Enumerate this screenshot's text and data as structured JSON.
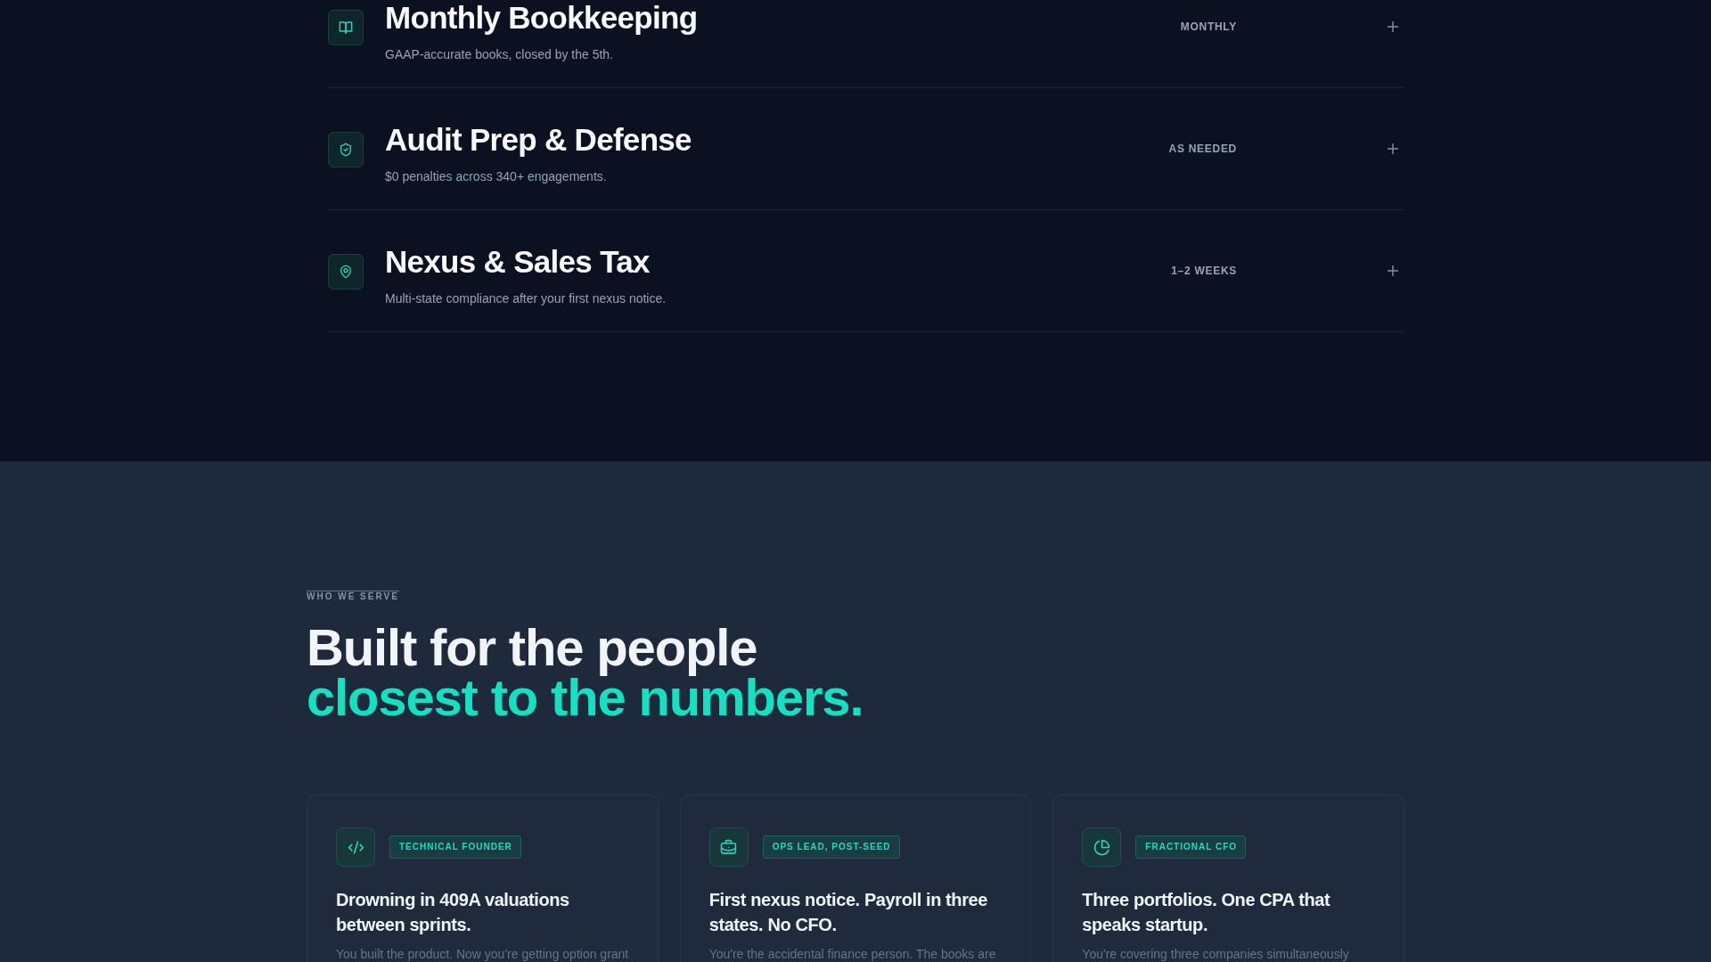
{
  "services": [
    {
      "title": "Monthly Bookkeeping",
      "description": "GAAP-accurate books, closed by the 5th.",
      "cadence": "MONTHLY",
      "expanded": false
    },
    {
      "title": "Audit Prep & Defense",
      "description": "$0 penalties across 340+ engagements.",
      "cadence": "AS NEEDED",
      "expanded": false
    },
    {
      "title": "Nexus & Sales Tax",
      "description": "Multi-state compliance after your first nexus notice.",
      "cadence": "1–2 WEEKS",
      "expanded": false
    }
  ],
  "audience": {
    "eyebrow": "WHO WE SERVE",
    "heading": "Built for the people",
    "heading_accent": "closest to the numbers.",
    "cards": [
      {
        "tag": "TECHNICAL FOUNDER",
        "title": "Drowning in 409A valuations between sprints.",
        "body": "You built the product. Now you're getting option grant"
      },
      {
        "tag": "OPS LEAD, POST-SEED",
        "title": "First nexus notice. Payroll in three states. No CFO.",
        "body": "You're the accidental finance person. The books are"
      },
      {
        "tag": "FRACTIONAL CFO",
        "title": "Three portfolios. One CPA that speaks startup.",
        "body": "You're covering three companies simultaneously"
      }
    ]
  }
}
